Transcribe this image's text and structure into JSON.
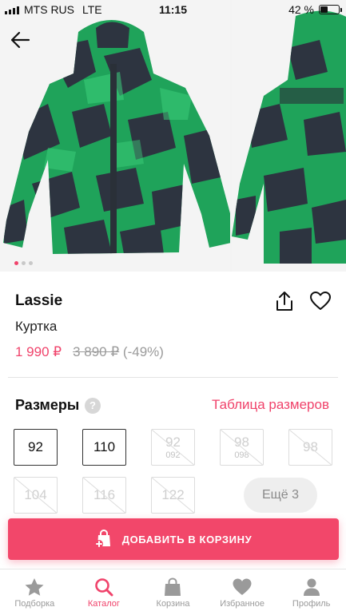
{
  "status_bar": {
    "carrier": "MTS RUS",
    "network": "LTE",
    "time": "11:15",
    "battery": "42 %",
    "battery_level": 0.42
  },
  "gallery": {
    "photo_count": 3,
    "active_index": 0
  },
  "product": {
    "brand": "Lassie",
    "type": "Куртка",
    "price": "1 990 ₽",
    "old_price": "3 890 ₽",
    "discount": "(-49%)"
  },
  "sizes": {
    "title": "Размеры",
    "help": "?",
    "table_link": "Таблица размеров",
    "items": [
      {
        "label": "92",
        "sub": "",
        "available": true
      },
      {
        "label": "110",
        "sub": "",
        "available": true
      },
      {
        "label": "92",
        "sub": "092",
        "available": false
      },
      {
        "label": "98",
        "sub": "098",
        "available": false
      },
      {
        "label": "98",
        "sub": "",
        "available": false
      },
      {
        "label": "104",
        "sub": "",
        "available": false
      },
      {
        "label": "116",
        "sub": "",
        "available": false
      },
      {
        "label": "122",
        "sub": "",
        "available": false
      }
    ],
    "more": "Ещё 3"
  },
  "cta": {
    "label": "ДОБАВИТЬ В КОРЗИНУ",
    "color": "#f2476a"
  },
  "tabbar": [
    {
      "label": "Подборка",
      "icon": "star-icon",
      "active": false
    },
    {
      "label": "Каталог",
      "icon": "search-icon",
      "active": true
    },
    {
      "label": "Корзина",
      "icon": "shopping-bag-icon",
      "active": false
    },
    {
      "label": "Избранное",
      "icon": "heart-icon",
      "active": false
    },
    {
      "label": "Профиль",
      "icon": "person-icon",
      "active": false
    }
  ],
  "colors": {
    "accent": "#f0436b",
    "jacket_green": "#1fa35a",
    "jacket_dark": "#2d3440"
  }
}
